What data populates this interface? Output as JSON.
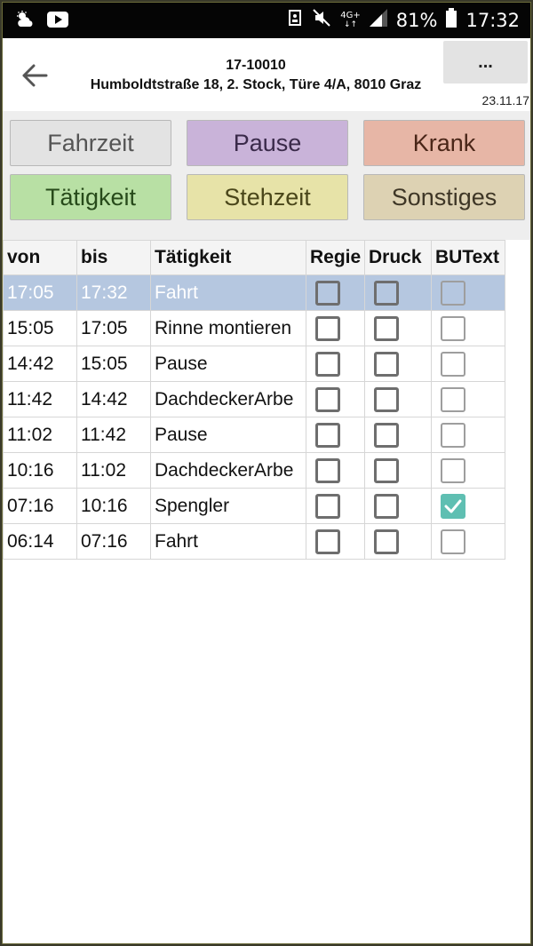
{
  "status_bar": {
    "icons_left": [
      "weather-icon",
      "youtube-icon"
    ],
    "network": "4G+",
    "battery_percent": "81%",
    "time": "17:32"
  },
  "header": {
    "job_number": "17-10010",
    "address": "Humboldtstraße 18, 2. Stock, Türe 4/A, 8010 Graz",
    "more_label": "...",
    "date": "23.11.17"
  },
  "categories": [
    {
      "label": "Fahrzeit",
      "color": "#e3e3e3",
      "text_color": "#555555"
    },
    {
      "label": "Pause",
      "color": "#c9b3d9",
      "text_color": "#3a2a4a"
    },
    {
      "label": "Krank",
      "color": "#e7b6a6",
      "text_color": "#4a2618"
    },
    {
      "label": "Tätigkeit",
      "color": "#b8e0a4",
      "text_color": "#274a1a"
    },
    {
      "label": "Stehzeit",
      "color": "#e7e3a8",
      "text_color": "#4a461a"
    },
    {
      "label": "Sonstiges",
      "color": "#ddd2b3",
      "text_color": "#3e3626"
    }
  ],
  "table": {
    "columns": [
      "von",
      "bis",
      "Tätigkeit",
      "Regie",
      "Druck",
      "BUText"
    ],
    "rows": [
      {
        "von": "17:05",
        "bis": "17:32",
        "activity": "Fahrt",
        "regie": false,
        "druck": false,
        "butext": false,
        "selected": true
      },
      {
        "von": "15:05",
        "bis": "17:05",
        "activity": "Rinne montieren",
        "regie": false,
        "druck": false,
        "butext": false,
        "selected": false
      },
      {
        "von": "14:42",
        "bis": "15:05",
        "activity": "Pause",
        "regie": false,
        "druck": false,
        "butext": false,
        "selected": false
      },
      {
        "von": "11:42",
        "bis": "14:42",
        "activity": "DachdeckerArbe",
        "regie": false,
        "druck": false,
        "butext": false,
        "selected": false
      },
      {
        "von": "11:02",
        "bis": "11:42",
        "activity": "Pause",
        "regie": false,
        "druck": false,
        "butext": false,
        "selected": false
      },
      {
        "von": "10:16",
        "bis": "11:02",
        "activity": "DachdeckerArbe",
        "regie": false,
        "druck": false,
        "butext": false,
        "selected": false
      },
      {
        "von": "07:16",
        "bis": "10:16",
        "activity": "Spengler",
        "regie": false,
        "druck": false,
        "butext": true,
        "selected": false
      },
      {
        "von": "06:14",
        "bis": "07:16",
        "activity": "Fahrt",
        "regie": false,
        "druck": false,
        "butext": false,
        "selected": false
      }
    ]
  }
}
